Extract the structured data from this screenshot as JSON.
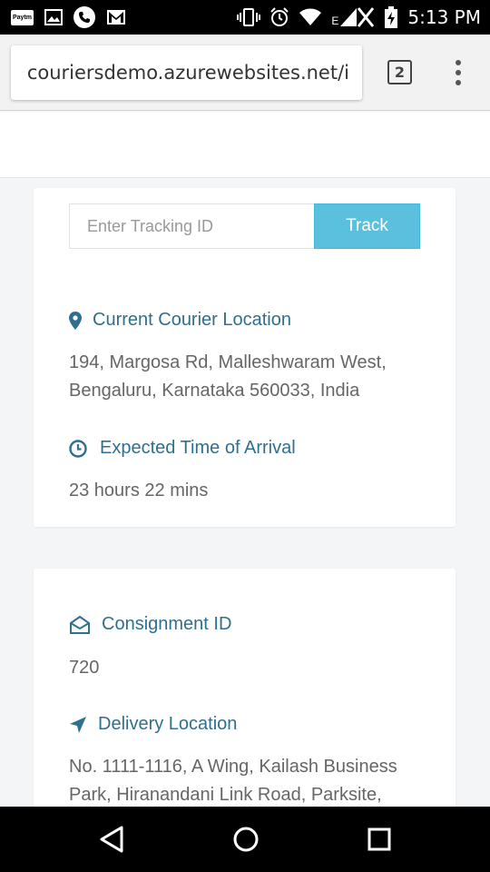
{
  "status_bar": {
    "time": "5:13 PM",
    "paytm_label": "Paytm",
    "network_label": "E",
    "icons": [
      "paytm-icon",
      "image-icon",
      "phone-icon",
      "gmail-icon",
      "vibrate-icon",
      "alarm-icon",
      "wifi-icon",
      "signal-icon",
      "battery-charging-icon"
    ]
  },
  "browser": {
    "url": "couriersdemo.azurewebsites.net/i",
    "tab_count": "2"
  },
  "tracking": {
    "placeholder": "Enter Tracking ID",
    "value": "",
    "button_label": "Track"
  },
  "current_location": {
    "heading": "Current Courier Location",
    "line1": "194, Margosa Rd, Malleshwaram West,",
    "line2": "Bengaluru, Karnataka 560033, India"
  },
  "eta": {
    "heading": "Expected Time of Arrival",
    "value": "23 hours 22 mins"
  },
  "consignment": {
    "heading": "Consignment ID",
    "value": "720"
  },
  "delivery": {
    "heading": "Delivery Location",
    "line1": "No. 1111-1116, A Wing, Kailash Business",
    "line2": "Park, Hiranandani Link Road, Parksite,"
  },
  "colors": {
    "accent": "#2f6f8f",
    "button": "#5bc0de",
    "text": "#666666",
    "background": "#f3f5f7"
  }
}
